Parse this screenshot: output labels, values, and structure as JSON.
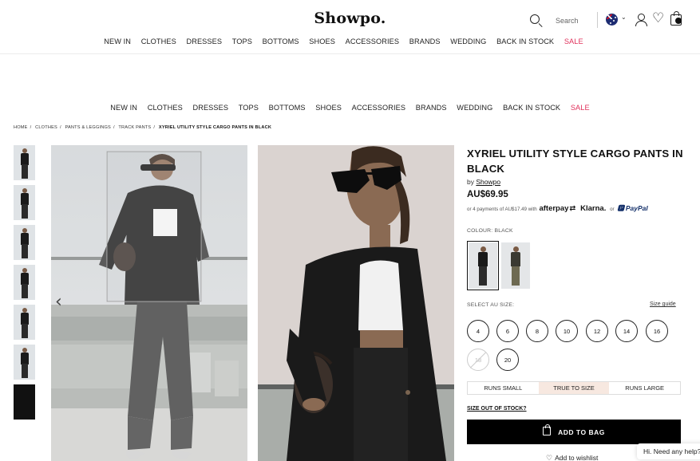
{
  "brand": "Showpo.",
  "nav": {
    "items": [
      "NEW IN",
      "CLOTHES",
      "DRESSES",
      "TOPS",
      "BOTTOMS",
      "SHOES",
      "ACCESSORIES",
      "BRANDS",
      "WEDDING",
      "BACK IN STOCK",
      "SALE"
    ]
  },
  "header": {
    "search_label": "Search"
  },
  "breadcrumb": [
    "HOME",
    "CLOTHES",
    "PANTS & LEGGINGS",
    "TRACK PANTS",
    "XYRIEL UTILITY STYLE CARGO PANTS IN BLACK"
  ],
  "product": {
    "title": "XYRIEL UTILITY STYLE CARGO PANTS IN BLACK",
    "by_prefix": "by",
    "brand_link": "Showpo",
    "price": "AU$69.95",
    "installments_text": "or 4 payments of AU$17.49 with",
    "afterpay": "afterpay",
    "klarna": "Klarna.",
    "or": "or",
    "paypal": "PayPal",
    "colour_label": "COLOUR: BLACK",
    "size_label": "SELECT AU SIZE:",
    "size_guide": "Size guide",
    "sizes": [
      "4",
      "6",
      "8",
      "10",
      "12",
      "14",
      "16",
      "18",
      "20"
    ],
    "fit_options": [
      "RUNS SMALL",
      "TRUE TO SIZE",
      "RUNS LARGE"
    ],
    "size_out_of_stock": "SIZE OUT OF STOCK?",
    "add_to_bag": "ADD TO BAG",
    "add_to_wishlist": "Add to wishlist"
  },
  "chat": {
    "label": "Hi. Need any help?"
  },
  "colors": {
    "sale": "#e0315b",
    "primary_button": "#000000",
    "fit_active": "#f7e8e0"
  }
}
